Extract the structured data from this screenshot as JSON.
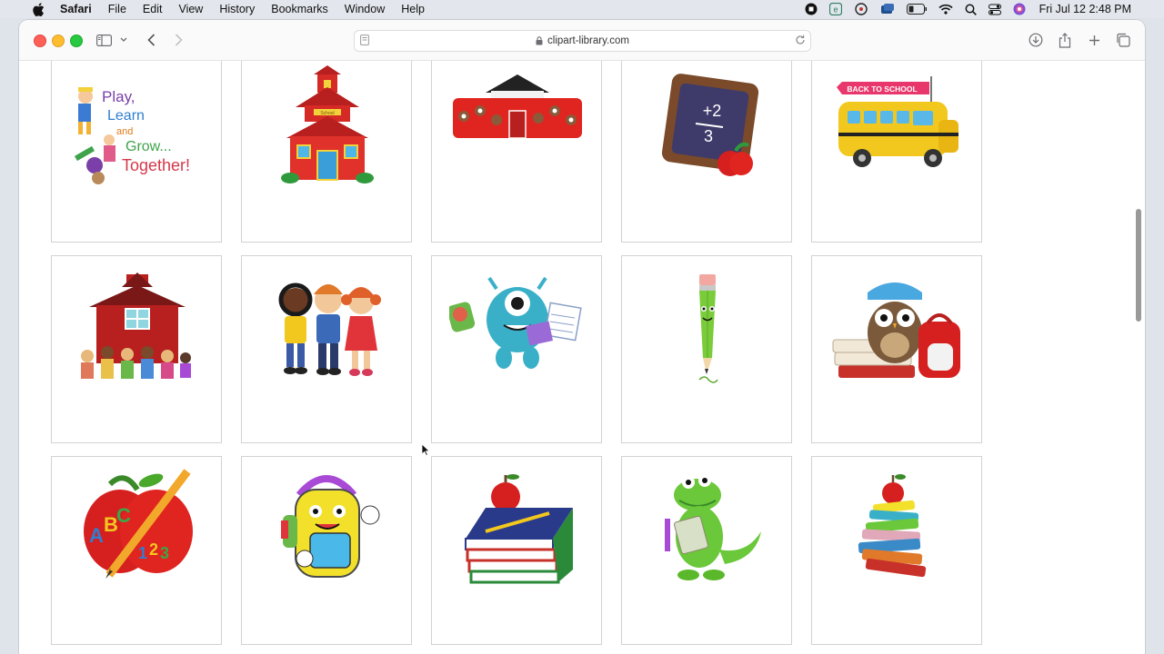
{
  "menubar": {
    "app": "Safari",
    "items": [
      "File",
      "Edit",
      "View",
      "History",
      "Bookmarks",
      "Window",
      "Help"
    ],
    "clock": "Fri Jul 12  2:48 PM"
  },
  "browser": {
    "url": "clipart-library.com"
  },
  "gallery": {
    "rows": [
      [
        {
          "name": "play-learn-grow",
          "caption": [
            "Play,",
            "Learn",
            "and",
            "Grow...",
            "Together!"
          ]
        },
        {
          "name": "red-schoolhouse",
          "caption": [
            "School"
          ]
        },
        {
          "name": "schoolhouse-with-kids"
        },
        {
          "name": "chalkboard-apple",
          "caption": [
            "+2",
            "3"
          ]
        },
        {
          "name": "school-bus",
          "caption": [
            "BACK TO SCHOOL"
          ]
        }
      ],
      [
        {
          "name": "barn-school-kids"
        },
        {
          "name": "three-kids"
        },
        {
          "name": "one-eyed-monster"
        },
        {
          "name": "pencil-character"
        },
        {
          "name": "owl-books-backpack"
        }
      ],
      [
        {
          "name": "apple-abc-pencil",
          "caption": [
            "A",
            "B",
            "C",
            "1",
            "2",
            "3"
          ]
        },
        {
          "name": "backpack-character"
        },
        {
          "name": "books-with-apple"
        },
        {
          "name": "crocodile-reading"
        },
        {
          "name": "stacked-books-apple"
        }
      ]
    ]
  }
}
